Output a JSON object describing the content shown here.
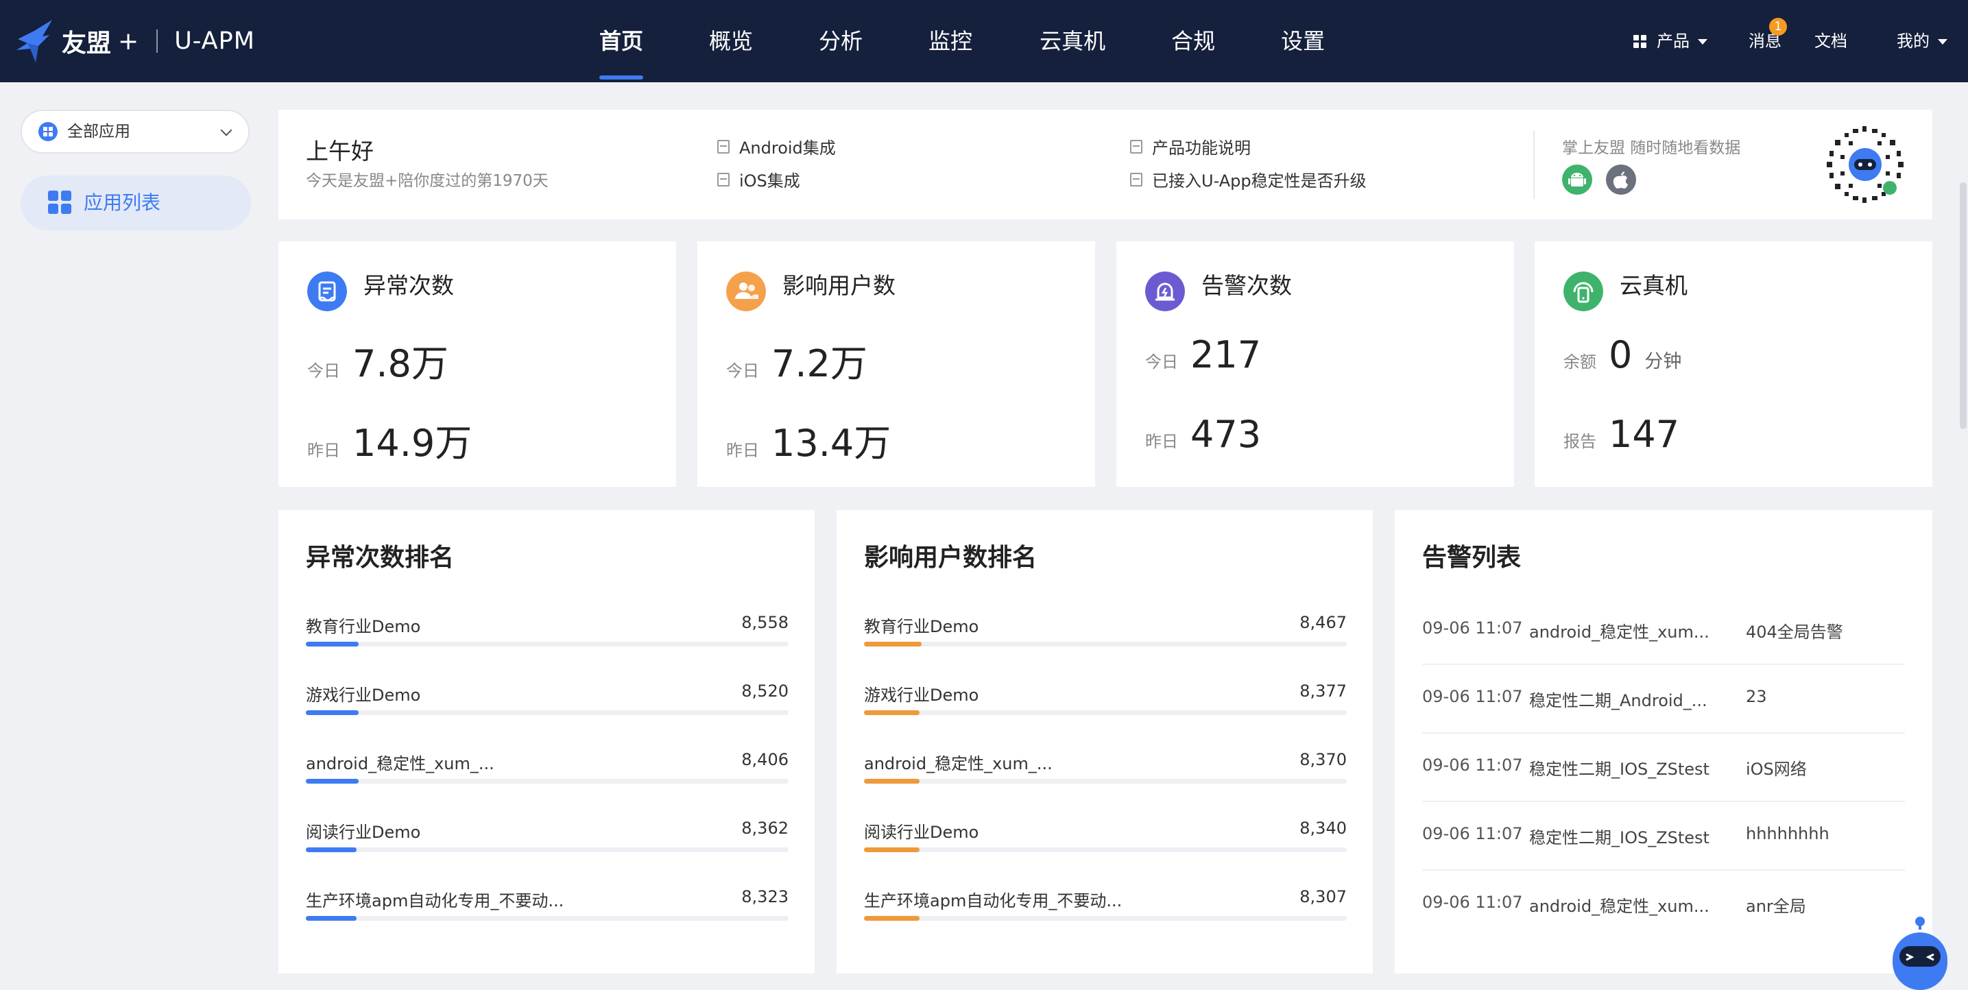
{
  "brand": {
    "name": "友盟",
    "plus": "+",
    "product": "U-APM"
  },
  "nav": {
    "tabs": [
      "首页",
      "概览",
      "分析",
      "监控",
      "云真机",
      "合规",
      "设置"
    ],
    "active": 0
  },
  "top_right": {
    "products": "产品",
    "messages": "消息",
    "message_badge": "1",
    "docs": "文档",
    "mine": "我的"
  },
  "sidebar": {
    "app_select": "全部应用",
    "items": [
      {
        "label": "应用列表"
      }
    ]
  },
  "greeting": {
    "title": "上午好",
    "subtitle": "今天是友盟+陪你度过的第1970天",
    "links": [
      "Android集成",
      "iOS集成",
      "产品功能说明",
      "已接入U-App稳定性是否升级"
    ],
    "mobile_text": "掌上友盟 随时随地看数据"
  },
  "stats": [
    {
      "title": "异常次数",
      "row1_label": "今日",
      "row1_value": "7.8万",
      "row2_label": "昨日",
      "row2_value": "14.9万",
      "color": "#3e7bf2"
    },
    {
      "title": "影响用户数",
      "row1_label": "今日",
      "row1_value": "7.2万",
      "row2_label": "昨日",
      "row2_value": "13.4万",
      "color": "#f5a04a"
    },
    {
      "title": "告警次数",
      "row1_label": "今日",
      "row1_value": "217",
      "row2_label": "昨日",
      "row2_value": "473",
      "color": "#6b5bd2"
    },
    {
      "title": "云真机",
      "row1_label": "余额",
      "row1_value": "0",
      "row1_unit": "分钟",
      "row2_label": "报告",
      "row2_value": "147",
      "color": "#3fb36b"
    }
  ],
  "exception_rank": {
    "title": "异常次数排名",
    "color": "#3e7bf2",
    "items": [
      {
        "name": "教育行业Demo",
        "value": "8,558",
        "share": 0.11
      },
      {
        "name": "游戏行业Demo",
        "value": "8,520",
        "share": 0.11
      },
      {
        "name": "android_稳定性_xum_...",
        "value": "8,406",
        "share": 0.11
      },
      {
        "name": "阅读行业Demo",
        "value": "8,362",
        "share": 0.105
      },
      {
        "name": "生产环境apm自动化专用_不要动...",
        "value": "8,323",
        "share": 0.105
      }
    ]
  },
  "user_rank": {
    "title": "影响用户数排名",
    "color": "#ee9a3a",
    "items": [
      {
        "name": "教育行业Demo",
        "value": "8,467",
        "share": 0.12
      },
      {
        "name": "游戏行业Demo",
        "value": "8,377",
        "share": 0.115
      },
      {
        "name": "android_稳定性_xum_...",
        "value": "8,370",
        "share": 0.115
      },
      {
        "name": "阅读行业Demo",
        "value": "8,340",
        "share": 0.115
      },
      {
        "name": "生产环境apm自动化专用_不要动...",
        "value": "8,307",
        "share": 0.115
      }
    ]
  },
  "alerts": {
    "title": "告警列表",
    "rows": [
      {
        "time": "09-06 11:07",
        "app": "android_稳定性_xum...",
        "rule": "404全局告警"
      },
      {
        "time": "09-06 11:07",
        "app": "稳定性二期_Android_...",
        "rule": "23"
      },
      {
        "time": "09-06 11:07",
        "app": "稳定性二期_IOS_ZStest",
        "rule": "iOS网络"
      },
      {
        "time": "09-06 11:07",
        "app": "稳定性二期_IOS_ZStest",
        "rule": "hhhhhhhh"
      },
      {
        "time": "09-06 11:07",
        "app": "android_稳定性_xum...",
        "rule": "anr全局"
      }
    ]
  }
}
